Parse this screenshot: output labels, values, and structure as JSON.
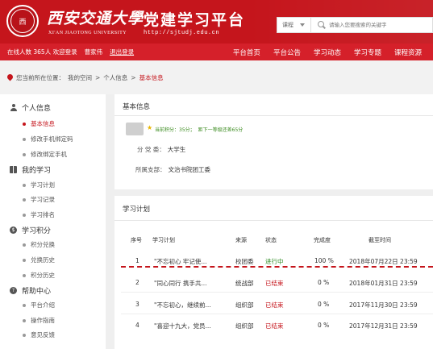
{
  "header": {
    "logo_text": "西",
    "university_cn": "西安交通大學",
    "university_en": "XI'AN JIAOTONG UNIVERSITY",
    "platform_title": "党建学习平台",
    "site_url": "http://sjtudj.edu.cn",
    "search": {
      "category": "课程",
      "placeholder": "请输入您要搜索的关键字"
    },
    "brand_color": "#c5151c"
  },
  "navbar": {
    "online_text": "在线人数 365人 欢迎登录",
    "user_name": "曹家伟",
    "logout": "退出登录",
    "items": [
      "平台首页",
      "平台公告",
      "学习动态",
      "学习专题",
      "课程资源"
    ]
  },
  "breadcrumb": {
    "prefix": "您当前所在位置：",
    "items": [
      "我的空间",
      "个人信息",
      "基本信息"
    ],
    "separator": ">"
  },
  "sidebar": {
    "sections": [
      {
        "title": "个人信息",
        "icon": "person-icon",
        "items": [
          "基本信息",
          "修改手机绑定码",
          "修改绑定手机"
        ]
      },
      {
        "title": "我的学习",
        "icon": "book-icon",
        "items": [
          "学习计划",
          "学习记录",
          "学习排名"
        ]
      },
      {
        "title": "学习积分",
        "icon": "points-icon",
        "items": [
          "积分兑换",
          "兑换历史",
          "积分历史"
        ]
      },
      {
        "title": "帮助中心",
        "icon": "help-icon",
        "items": [
          "平台介绍",
          "操作指南",
          "意见反馈"
        ]
      }
    ],
    "active_item": "基本信息"
  },
  "basic_info": {
    "title": "基本信息",
    "points_text": "当前积分：35分；",
    "next_level_text": "距下一等级还差65分",
    "party_committee_label": "分 党 委：",
    "party_committee_value": "大学生",
    "branch_label": "所属支部：",
    "branch_value": "文治书院团工委"
  },
  "study_plan": {
    "title": "学习计划",
    "columns": [
      "序号",
      "学习计划",
      "来源",
      "状态",
      "完成度",
      "截至时间"
    ],
    "rows": [
      {
        "no": "1",
        "plan": "\"不忘初心 牢记使...",
        "source": "校团委",
        "status": "进行中",
        "status_type": "ongoing",
        "progress": "100 %",
        "deadline": "2018年07月22日 23:59"
      },
      {
        "no": "2",
        "plan": "\"同心同行 携手共...",
        "source": "统战部",
        "status": "已结束",
        "status_type": "ended",
        "progress": "0 %",
        "deadline": "2018年01月31日 23:59"
      },
      {
        "no": "3",
        "plan": "\"不忘初心，继续前...",
        "source": "组织部",
        "status": "已结束",
        "status_type": "ended",
        "progress": "0 %",
        "deadline": "2017年11月30日 23:59"
      },
      {
        "no": "4",
        "plan": "\"喜迎十九大，党员...",
        "source": "组织部",
        "status": "已结束",
        "status_type": "ended",
        "progress": "0 %",
        "deadline": "2017年12月31日 23:59"
      }
    ],
    "status_colors": {
      "ongoing": "#2e8b23",
      "ended": "#c5151c"
    }
  }
}
